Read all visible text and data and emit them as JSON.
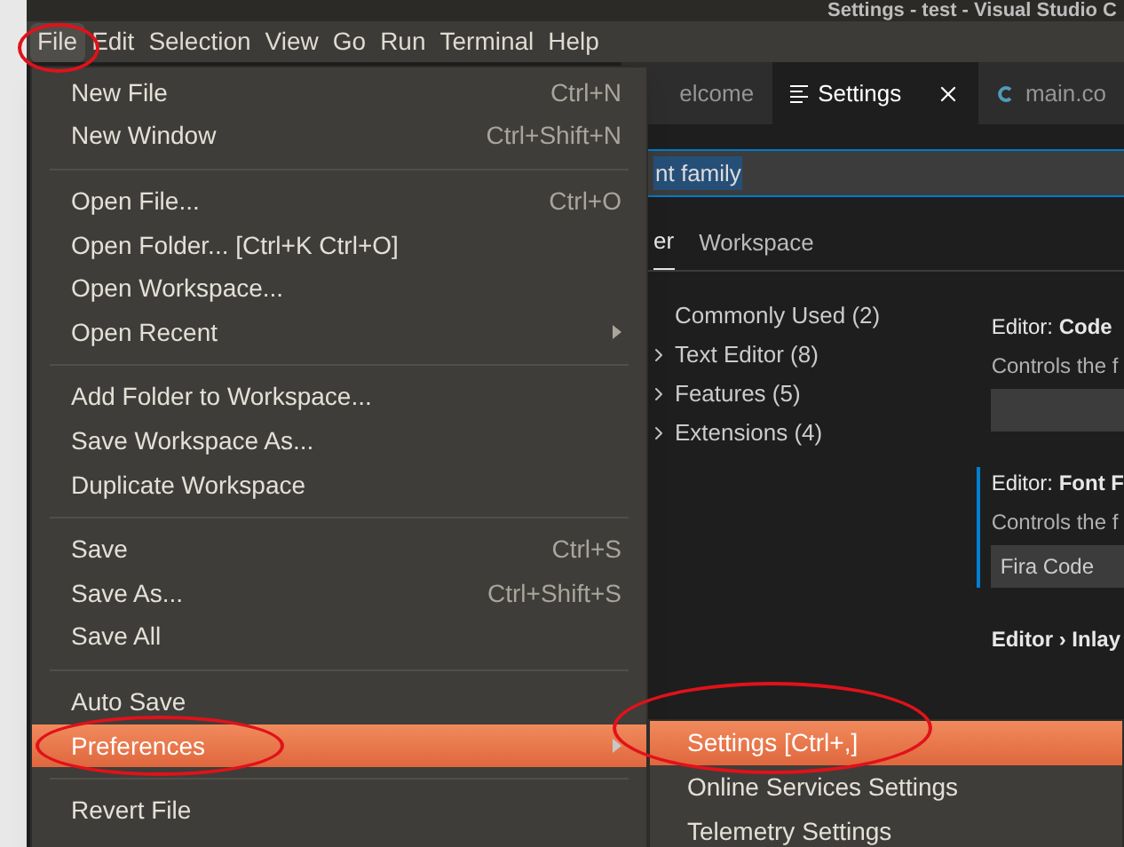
{
  "window": {
    "title": "Settings - test - Visual Studio C"
  },
  "menu_bar": [
    {
      "label": "File",
      "selected": true
    },
    {
      "label": "Edit",
      "selected": false
    },
    {
      "label": "Selection",
      "selected": false
    },
    {
      "label": "View",
      "selected": false
    },
    {
      "label": "Go",
      "selected": false
    },
    {
      "label": "Run",
      "selected": false
    },
    {
      "label": "Terminal",
      "selected": false
    },
    {
      "label": "Help",
      "selected": false
    }
  ],
  "editor_tabs": [
    {
      "label": "elcome",
      "selected": false,
      "kind": "plain"
    },
    {
      "label": "Settings",
      "selected": true,
      "kind": "settings"
    },
    {
      "label": "main.co",
      "selected": false,
      "kind": "code"
    }
  ],
  "search": {
    "value": "nt family"
  },
  "scope_tabs": [
    {
      "label": "er",
      "selected": true
    },
    {
      "label": "Workspace",
      "selected": false
    }
  ],
  "toc": [
    {
      "label": "Commonly Used (2)",
      "expandable": false
    },
    {
      "label": "Text Editor (8)",
      "expandable": true
    },
    {
      "label": "Features (5)",
      "expandable": true
    },
    {
      "label": "Extensions (4)",
      "expandable": true
    }
  ],
  "settings": [
    {
      "category": "Editor: ",
      "name": "Code",
      "description": "Controls the f",
      "focused": false
    },
    {
      "category": "Editor: ",
      "name": "Font F",
      "description": "Controls the f",
      "value": "Fira Code",
      "focused": true
    }
  ],
  "next_setting": "Editor › Inlay",
  "file_menu": [
    {
      "kind": "item",
      "label": "New File",
      "shortcut": "Ctrl+N",
      "selected": false
    },
    {
      "kind": "item",
      "label": "New Window",
      "shortcut": "Ctrl+Shift+N",
      "selected": false
    },
    {
      "kind": "separator"
    },
    {
      "kind": "item",
      "label": "Open File...",
      "shortcut": "Ctrl+O",
      "selected": false
    },
    {
      "kind": "item",
      "label": "Open Folder... [Ctrl+K Ctrl+O]",
      "selected": false
    },
    {
      "kind": "item",
      "label": "Open Workspace...",
      "selected": false
    },
    {
      "kind": "submenu",
      "label": "Open Recent",
      "selected": false
    },
    {
      "kind": "separator"
    },
    {
      "kind": "item",
      "label": "Add Folder to Workspace...",
      "selected": false
    },
    {
      "kind": "item",
      "label": "Save Workspace As...",
      "selected": false
    },
    {
      "kind": "item",
      "label": "Duplicate Workspace",
      "selected": false
    },
    {
      "kind": "separator"
    },
    {
      "kind": "item",
      "label": "Save",
      "shortcut": "Ctrl+S",
      "selected": false
    },
    {
      "kind": "item",
      "label": "Save As...",
      "shortcut": "Ctrl+Shift+S",
      "selected": false
    },
    {
      "kind": "item",
      "label": "Save All",
      "selected": false
    },
    {
      "kind": "separator"
    },
    {
      "kind": "item",
      "label": "Auto Save",
      "selected": false
    },
    {
      "kind": "submenu",
      "label": "Preferences",
      "selected": true
    },
    {
      "kind": "separator"
    },
    {
      "kind": "item",
      "label": "Revert File",
      "selected": false
    }
  ],
  "preferences_submenu": [
    {
      "label": "Settings [Ctrl+,]",
      "selected": true
    },
    {
      "label": "Online Services Settings",
      "selected": false
    },
    {
      "label": "Telemetry Settings",
      "selected": false
    }
  ]
}
